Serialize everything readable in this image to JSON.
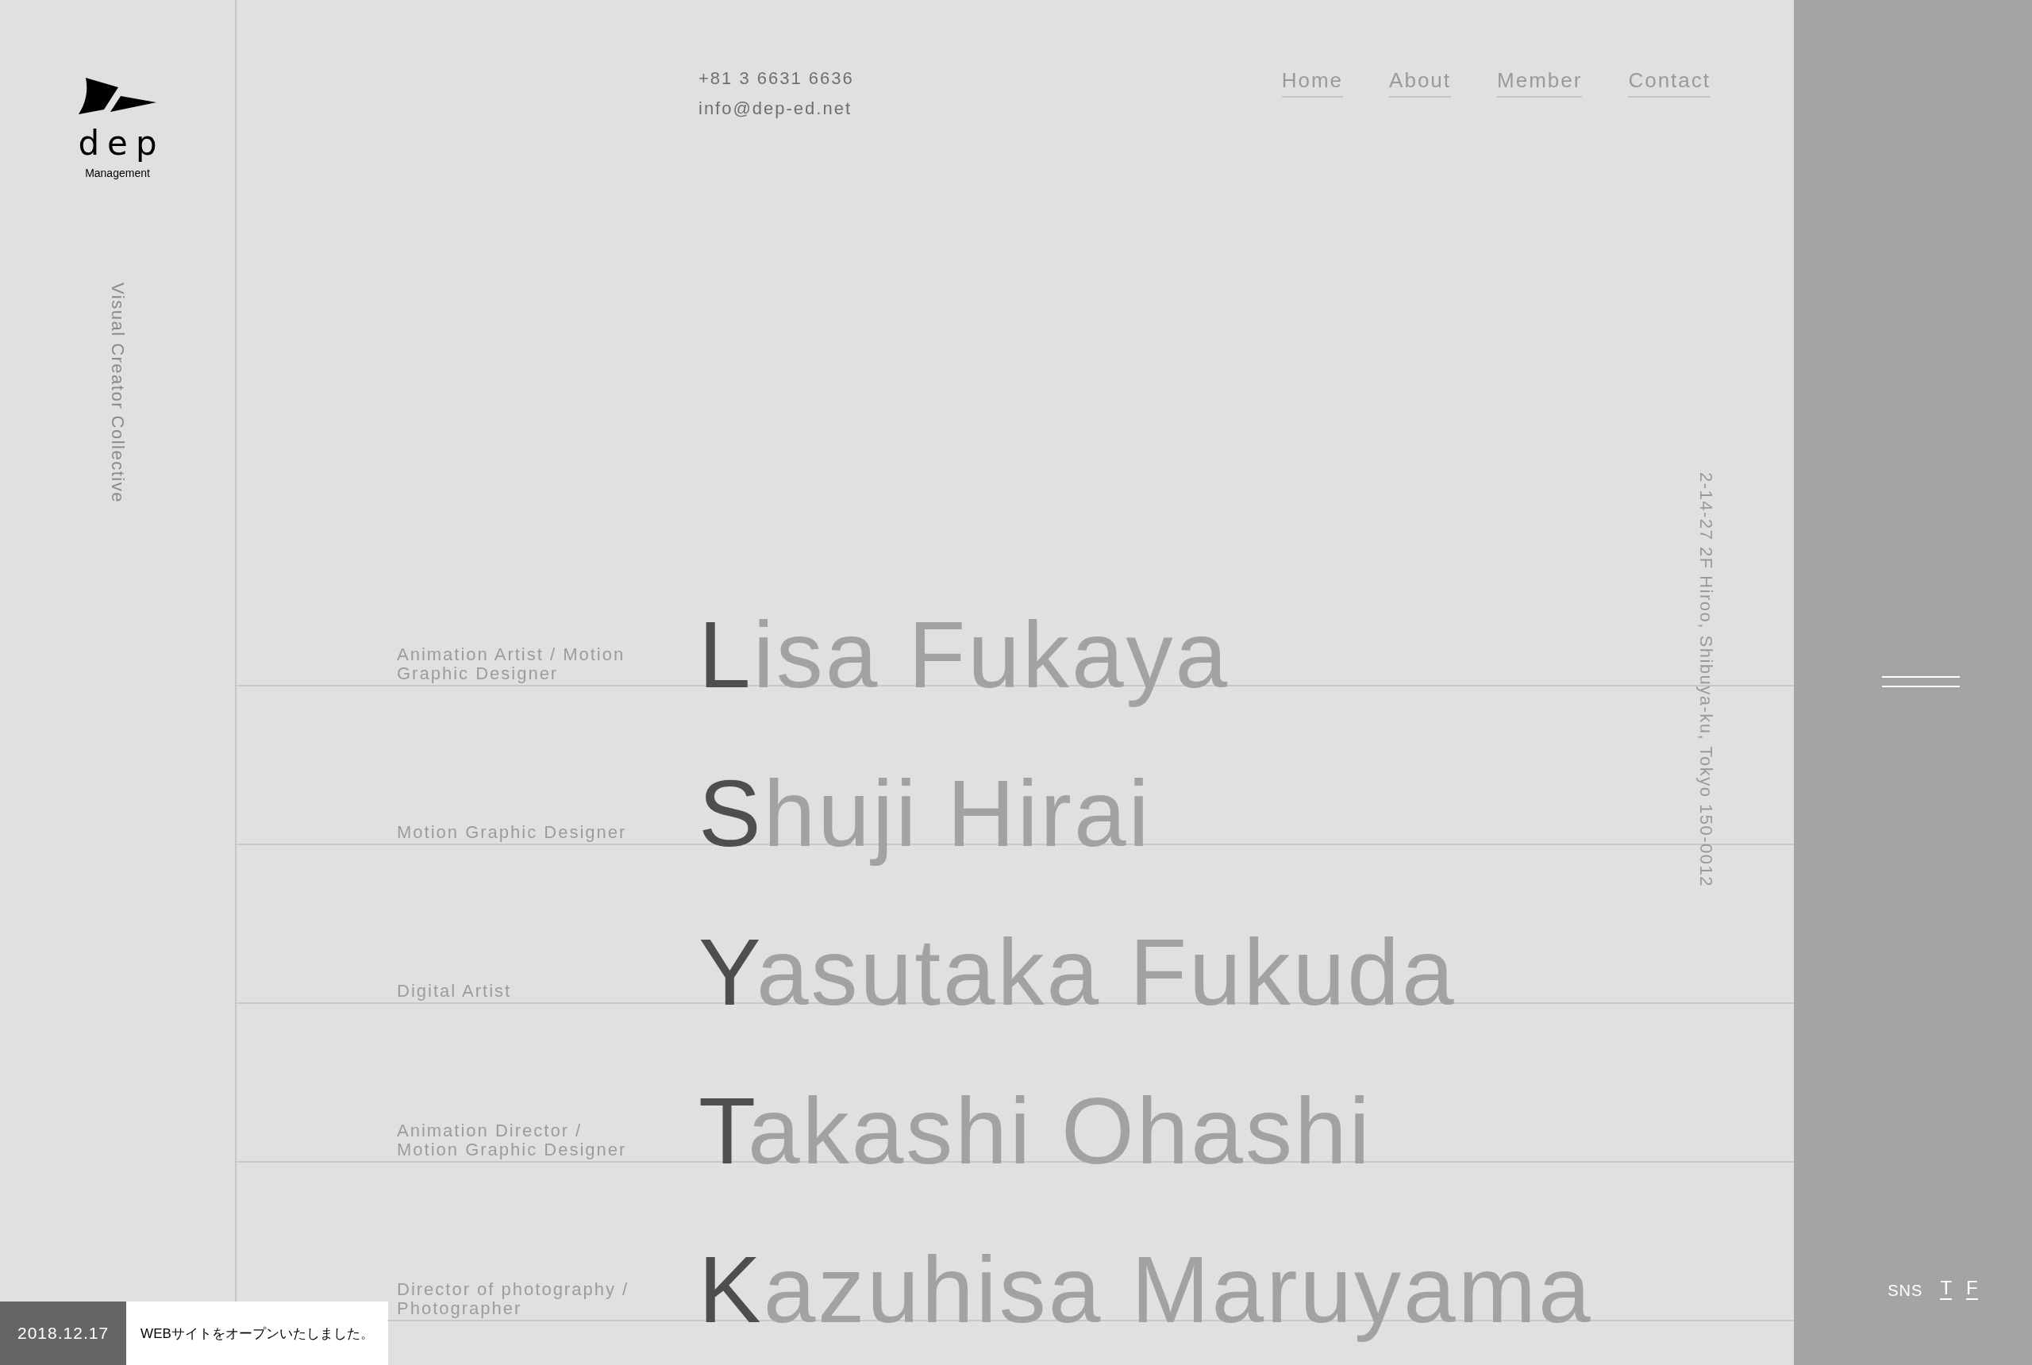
{
  "logo": {
    "wordmark": "dep",
    "subtitle": "Management"
  },
  "tagline": "Visual Creator Collective",
  "contact": {
    "phone": "+81 3 6631 6636",
    "email": "info@dep-ed.net"
  },
  "nav": [
    {
      "label": "Home"
    },
    {
      "label": "About"
    },
    {
      "label": "Member"
    },
    {
      "label": "Contact"
    }
  ],
  "address": "2-14-27 2F Hiroo, Shibuya-ku, Tokyo 150-0012",
  "members": [
    {
      "role": "Animation Artist / Motion Graphic Designer",
      "name": "Lisa Fukaya"
    },
    {
      "role": "Motion Graphic Designer",
      "name": "Shuji Hirai"
    },
    {
      "role": "Digital Artist",
      "name": "Yasutaka Fukuda"
    },
    {
      "role": "Animation Director / Motion Graphic Designer",
      "name": "Takashi Ohashi"
    },
    {
      "role": "Director of photography / Photographer",
      "name": "Kazuhisa Maruyama"
    }
  ],
  "sns": {
    "label": "SNS",
    "links": [
      {
        "label": "T"
      },
      {
        "label": "F"
      }
    ]
  },
  "notice": {
    "date": "2018.12.17",
    "message": "WEBサイトをオープンいたしました。"
  }
}
